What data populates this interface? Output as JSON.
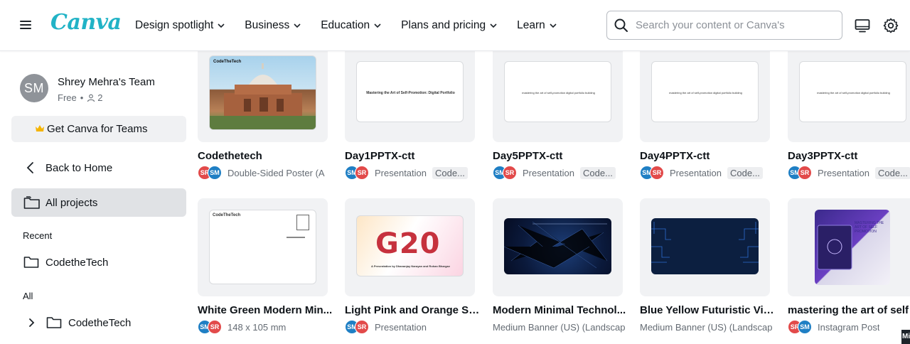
{
  "app": {
    "logo": "Canva",
    "nav": [
      "Design spotlight",
      "Business",
      "Education",
      "Plans and pricing",
      "Learn"
    ],
    "search_placeholder": "Search your content or Canva's"
  },
  "sidebar": {
    "avatar_initials": "SM",
    "team_name": "Shrey Mehra's Team",
    "plan": "Free",
    "members": "2",
    "teams_button": "Get Canva for Teams",
    "back_home": "Back to Home",
    "all_projects": "All projects",
    "recent_heading": "Recent",
    "recent_folder": "CodetheTech",
    "all_heading": "All",
    "all_folder": "CodetheTech"
  },
  "cards": [
    {
      "title": "Codethetech",
      "chips": [
        "SR",
        "SM"
      ],
      "type": "Double-Sided Poster (A",
      "folder": ""
    },
    {
      "title": "Day1PPTX-ctt",
      "chips": [
        "SM",
        "SR"
      ],
      "type": "Presentation",
      "folder": "Code..."
    },
    {
      "title": "Day5PPTX-ctt",
      "chips": [
        "SM",
        "SR"
      ],
      "type": "Presentation",
      "folder": "Code..."
    },
    {
      "title": "Day4PPTX-ctt",
      "chips": [
        "SM",
        "SR"
      ],
      "type": "Presentation",
      "folder": "Code..."
    },
    {
      "title": "Day3PPTX-ctt",
      "chips": [
        "SM",
        "SR"
      ],
      "type": "Presentation",
      "folder": "Code..."
    },
    {
      "title": "White Green Modern Min...",
      "chips": [
        "SM",
        "SR"
      ],
      "type": "148 x 105 mm",
      "folder": ""
    },
    {
      "title": "Light Pink and Orange So...",
      "chips": [
        "SM",
        "SR"
      ],
      "type": "Presentation",
      "folder": ""
    },
    {
      "title": "Modern Minimal Technol...",
      "chips": [],
      "type": "Medium Banner (US) (Landscap",
      "folder": ""
    },
    {
      "title": "Blue Yellow Futuristic Vir...",
      "chips": [],
      "type": "Medium Banner (US) (Landscap",
      "folder": ""
    },
    {
      "title": "mastering the art of self ...",
      "chips": [
        "SR",
        "SM"
      ],
      "type": "Instagram Post",
      "folder": ""
    }
  ],
  "thumb_text": {
    "codethetech_logo": "CodeTheTech",
    "day1_title": "Mastering the Art of Self-Promotion: Digital Portfolio",
    "day_small": "mastering the art of self-promotion digital portfolio building",
    "g20": "G20",
    "g20_caption": "A Presentation by Dhananjay Narayan and Rohan Bhargav",
    "postcard_logo": "CodeTheTech",
    "ig_title": "MASTERING THE ART OF SELF PROMOTION"
  },
  "corner_tag": "Mi",
  "colors": {
    "brand": "#21b3c6",
    "chip_red": "#e24a4a",
    "chip_blue": "#1f7fc4"
  }
}
